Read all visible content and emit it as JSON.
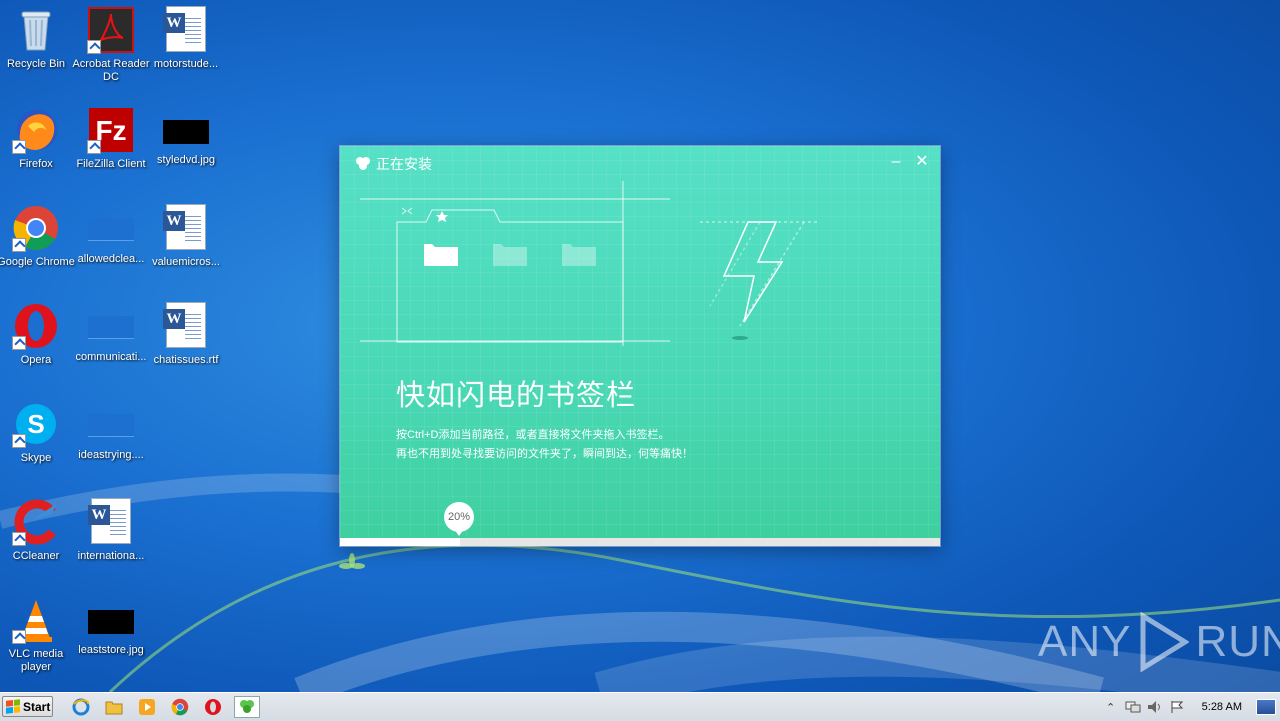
{
  "desktop": {
    "icons": [
      {
        "label": "Recycle Bin"
      },
      {
        "label": "Acrobat Reader DC"
      },
      {
        "label": "motorstude..."
      },
      {
        "label": "Firefox"
      },
      {
        "label": "FileZilla Client"
      },
      {
        "label": "styledvd.jpg"
      },
      {
        "label": "Google Chrome"
      },
      {
        "label": "allowedclea..."
      },
      {
        "label": "valuemicros..."
      },
      {
        "label": "Opera"
      },
      {
        "label": "communicati..."
      },
      {
        "label": "chatissues.rtf"
      },
      {
        "label": "Skype"
      },
      {
        "label": "ideastrying...."
      },
      {
        "label": "CCleaner"
      },
      {
        "label": "internationa..."
      },
      {
        "label": "VLC media player"
      },
      {
        "label": "leaststore.jpg"
      }
    ]
  },
  "installer": {
    "title": "正在安装",
    "minimize": "–",
    "close": "✕",
    "headline": "快如闪电的书签栏",
    "desc_line1": "按Ctrl+D添加当前路径，或者直接将文件夹拖入书签栏。",
    "desc_line2": "再也不用到处寻找要访问的文件夹了，瞬间到达，何等痛快！",
    "progress_label": "20%",
    "progress_fraction": 0.2
  },
  "taskbar": {
    "start_label": "Start",
    "clock": "5:28 AM"
  },
  "watermark": {
    "left": "ANY",
    "right": "RUN"
  },
  "colors": {
    "installer_top": "#56e0c6",
    "installer_bottom": "#3ecf9e",
    "desktop_blue": "#1a6fd0"
  }
}
